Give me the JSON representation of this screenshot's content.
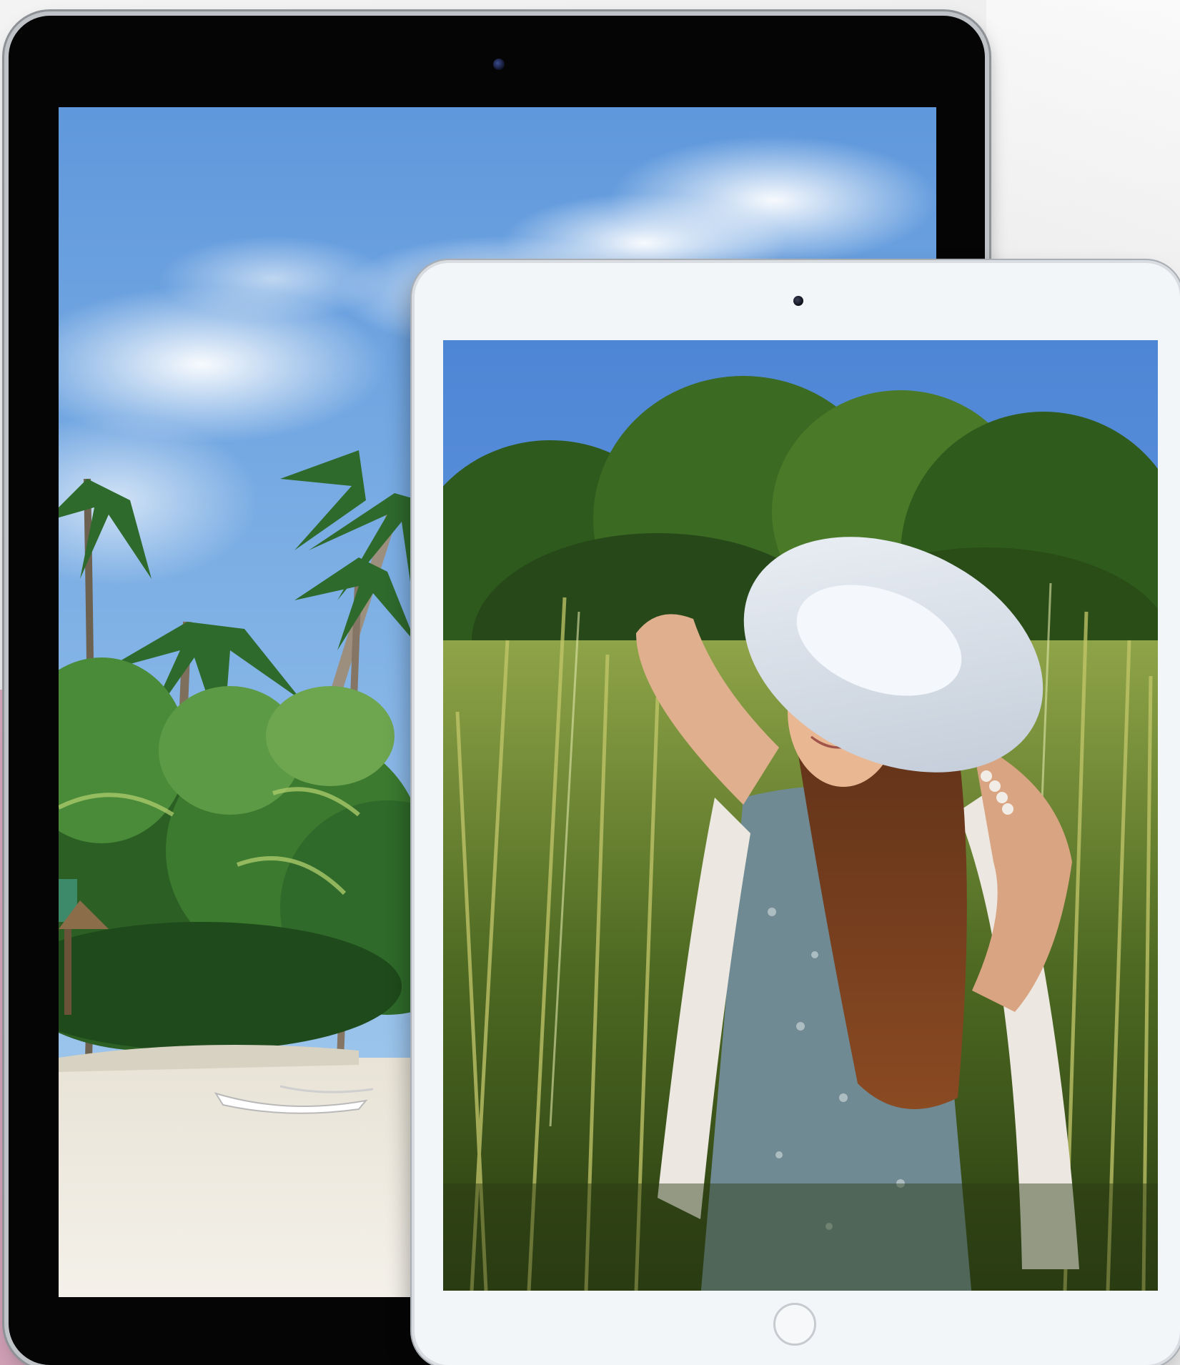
{
  "scene": {
    "description_icons": {
      "beach_photo": "beach-palm-photo",
      "portrait_photo": "woman-in-grass-photo"
    }
  },
  "colors": {
    "background": "#eeeeee",
    "pink_accent": "#d4a3b8",
    "ipad_pro_frame": "#050505",
    "ipad_frame": "#f3f6f8",
    "sky": "#6fa4e0"
  }
}
